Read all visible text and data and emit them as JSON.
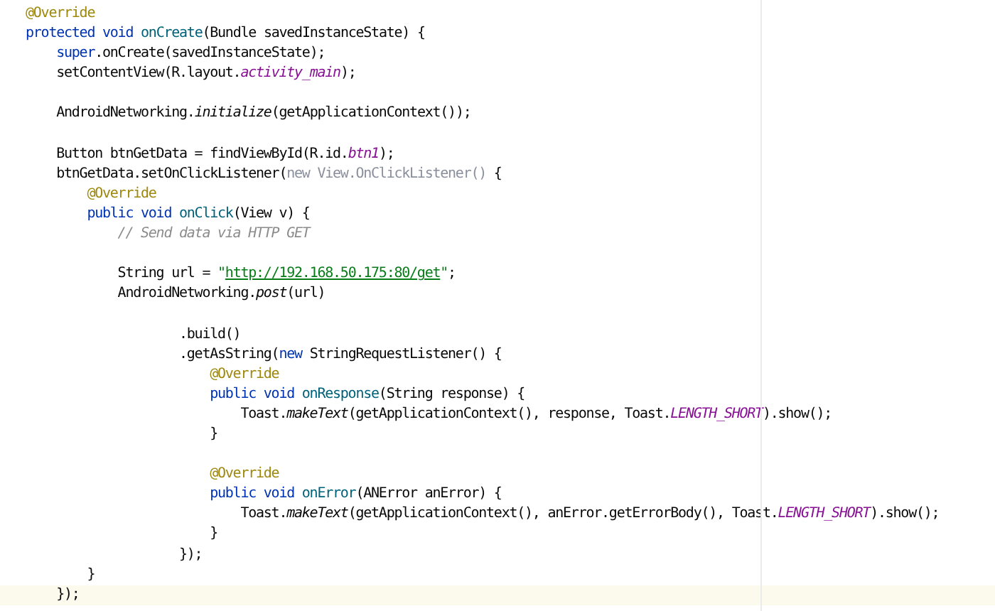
{
  "editor": {
    "lines": [
      {
        "current": false,
        "tokens": [
          {
            "kind": "annotation",
            "text": "@Override"
          }
        ]
      },
      {
        "current": false,
        "tokens": [
          {
            "kind": "keyword",
            "text": "protected void "
          },
          {
            "kind": "declaration",
            "text": "onCreate"
          },
          {
            "kind": "plain",
            "text": "(Bundle savedInstanceState) {"
          }
        ]
      },
      {
        "current": false,
        "tokens": [
          {
            "kind": "keyword",
            "text": "    super"
          },
          {
            "kind": "plain",
            "text": ".onCreate(savedInstanceState);"
          }
        ]
      },
      {
        "current": false,
        "tokens": [
          {
            "kind": "plain",
            "text": "    setContentView(R.layout."
          },
          {
            "kind": "field",
            "text": "activity_main"
          },
          {
            "kind": "plain",
            "text": ");"
          }
        ]
      },
      {
        "current": false
      },
      {
        "current": false,
        "tokens": [
          {
            "kind": "plain",
            "text": "    AndroidNetworking."
          },
          {
            "kind": "static",
            "text": "initialize"
          },
          {
            "kind": "plain",
            "text": "(getApplicationContext());"
          }
        ]
      },
      {
        "current": false
      },
      {
        "current": false,
        "tokens": [
          {
            "kind": "plain",
            "text": "    Button btnGetData = findViewById(R.id."
          },
          {
            "kind": "field",
            "text": "btn1"
          },
          {
            "kind": "plain",
            "text": ");"
          }
        ]
      },
      {
        "current": false,
        "tokens": [
          {
            "kind": "plain",
            "text": "    btnGetData.setOnClickListener("
          },
          {
            "kind": "faded",
            "text": "new View.OnClickListener()"
          },
          {
            "kind": "plain",
            "text": " {"
          }
        ]
      },
      {
        "current": false,
        "tokens": [
          {
            "kind": "annotation",
            "text": "        @Override"
          }
        ]
      },
      {
        "current": false,
        "tokens": [
          {
            "kind": "keyword",
            "text": "        public void "
          },
          {
            "kind": "declaration",
            "text": "onClick"
          },
          {
            "kind": "plain",
            "text": "(View v) {"
          }
        ]
      },
      {
        "current": false,
        "tokens": [
          {
            "kind": "comment",
            "text": "            // Send data via HTTP GET"
          }
        ]
      },
      {
        "current": false
      },
      {
        "current": false,
        "tokens": [
          {
            "kind": "plain",
            "text": "            String url = "
          },
          {
            "kind": "string",
            "text": "\""
          },
          {
            "kind": "url",
            "text": "http://192.168.50.175:80/get"
          },
          {
            "kind": "string",
            "text": "\""
          },
          {
            "kind": "plain",
            "text": ";"
          }
        ]
      },
      {
        "current": false,
        "tokens": [
          {
            "kind": "plain",
            "text": "            AndroidNetworking."
          },
          {
            "kind": "static",
            "text": "post"
          },
          {
            "kind": "plain",
            "text": "(url)"
          }
        ]
      },
      {
        "current": false
      },
      {
        "current": false,
        "tokens": [
          {
            "kind": "plain",
            "text": "                    .build()"
          }
        ]
      },
      {
        "current": false,
        "tokens": [
          {
            "kind": "plain",
            "text": "                    .getAsString("
          },
          {
            "kind": "keyword",
            "text": "new"
          },
          {
            "kind": "plain",
            "text": " StringRequestListener() {"
          }
        ]
      },
      {
        "current": false,
        "tokens": [
          {
            "kind": "annotation",
            "text": "                        @Override"
          }
        ]
      },
      {
        "current": false,
        "tokens": [
          {
            "kind": "keyword",
            "text": "                        public void "
          },
          {
            "kind": "declaration",
            "text": "onResponse"
          },
          {
            "kind": "plain",
            "text": "(String response) {"
          }
        ]
      },
      {
        "current": false,
        "tokens": [
          {
            "kind": "plain",
            "text": "                            Toast."
          },
          {
            "kind": "static",
            "text": "makeText"
          },
          {
            "kind": "plain",
            "text": "(getApplicationContext(), response, Toast."
          },
          {
            "kind": "field",
            "text": "LENGTH_SHORT"
          },
          {
            "kind": "plain",
            "text": ").show();"
          }
        ]
      },
      {
        "current": false,
        "tokens": [
          {
            "kind": "plain",
            "text": "                        }"
          }
        ]
      },
      {
        "current": false
      },
      {
        "current": false,
        "tokens": [
          {
            "kind": "annotation",
            "text": "                        @Override"
          }
        ]
      },
      {
        "current": false,
        "tokens": [
          {
            "kind": "keyword",
            "text": "                        public void "
          },
          {
            "kind": "declaration",
            "text": "onError"
          },
          {
            "kind": "plain",
            "text": "(ANError anError) {"
          }
        ]
      },
      {
        "current": false,
        "tokens": [
          {
            "kind": "plain",
            "text": "                            Toast."
          },
          {
            "kind": "static",
            "text": "makeText"
          },
          {
            "kind": "plain",
            "text": "(getApplicationContext(), anError.getErrorBody(), Toast."
          },
          {
            "kind": "field",
            "text": "LENGTH_SHORT"
          },
          {
            "kind": "plain",
            "text": ").show();"
          }
        ]
      },
      {
        "current": false,
        "tokens": [
          {
            "kind": "plain",
            "text": "                        }"
          }
        ]
      },
      {
        "current": false,
        "tokens": [
          {
            "kind": "plain",
            "text": "                    });"
          }
        ]
      },
      {
        "current": false,
        "tokens": [
          {
            "kind": "plain",
            "text": "        }"
          }
        ]
      },
      {
        "current": true,
        "tokens": [
          {
            "kind": "plain",
            "text": "    });"
          }
        ]
      }
    ]
  }
}
